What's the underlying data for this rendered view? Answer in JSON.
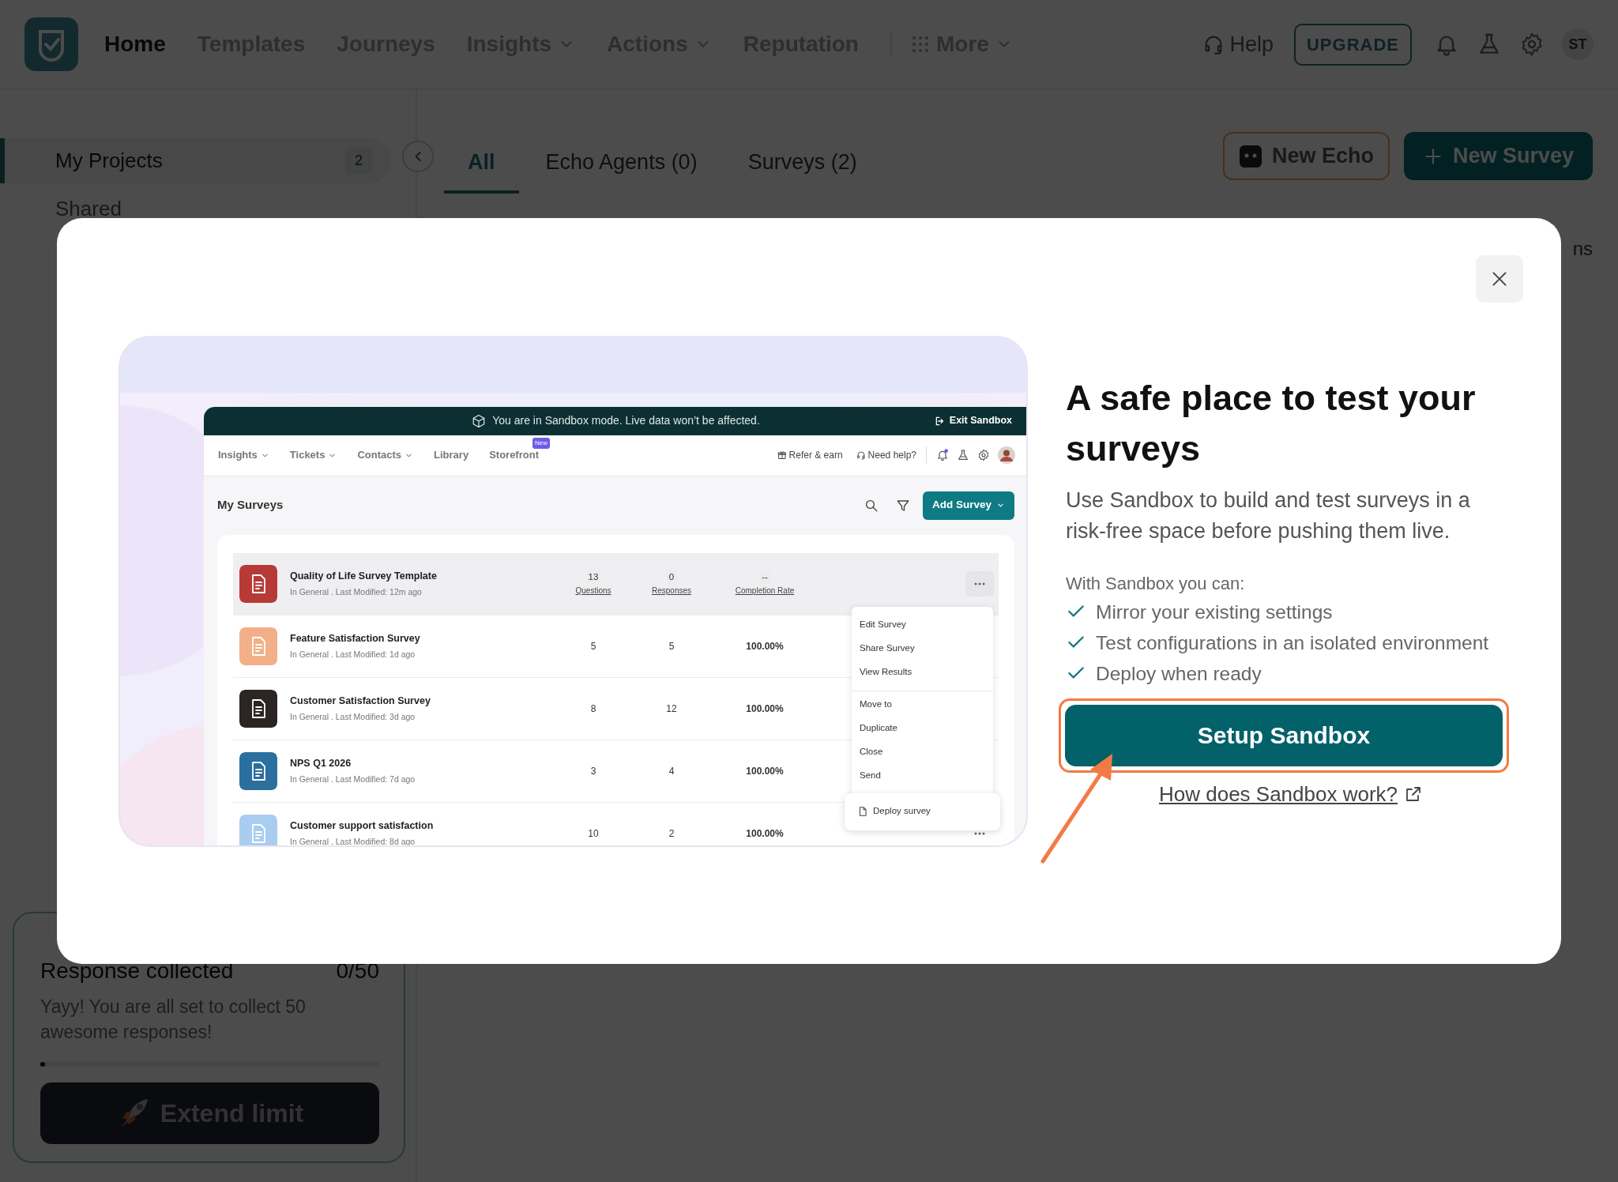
{
  "top_nav": {
    "items": [
      {
        "label": "Home",
        "selected": true,
        "dropdown": false
      },
      {
        "label": "Templates",
        "selected": false,
        "dropdown": false
      },
      {
        "label": "Journeys",
        "selected": false,
        "dropdown": false
      },
      {
        "label": "Insights",
        "selected": false,
        "dropdown": true
      },
      {
        "label": "Actions",
        "selected": false,
        "dropdown": true
      },
      {
        "label": "Reputation",
        "selected": false,
        "dropdown": false
      }
    ],
    "more": "More",
    "help": "Help",
    "upgrade": "UPGRADE",
    "avatar": "ST"
  },
  "sidebar": {
    "items": [
      {
        "label": "My Projects",
        "count": "2",
        "selected": true
      },
      {
        "label": "Shared",
        "selected": false
      }
    ]
  },
  "tabs": [
    {
      "label": "All",
      "selected": true
    },
    {
      "label": "Echo Agents (0)",
      "selected": false
    },
    {
      "label": "Surveys (2)",
      "selected": false
    }
  ],
  "header_buttons": {
    "new_echo": "New Echo",
    "new_survey": "New Survey"
  },
  "column_fragment": "ns",
  "usage_card": {
    "title": "Response collected",
    "count": "0/50",
    "message": "Yayy! You are all set to collect 50 awesome responses!",
    "level": 0.01,
    "button": "Extend limit"
  },
  "modal": {
    "preview": {
      "banner": "You are in Sandbox mode. Live data won’t be affected.",
      "exit": "Exit Sandbox",
      "nav": [
        {
          "label": "Insights",
          "dropdown": true
        },
        {
          "label": "Tickets",
          "dropdown": true
        },
        {
          "label": "Contacts",
          "dropdown": true
        },
        {
          "label": "Library",
          "dropdown": false
        },
        {
          "label": "Storefront",
          "dropdown": false,
          "badge": "New"
        }
      ],
      "refer": "Refer & earn",
      "help": "Need help?",
      "heading": "My Surveys",
      "add_button": "Add Survey",
      "rows": [
        {
          "title": "Quality of Life Survey Template",
          "meta": "In General . Last Modified: 12m ago",
          "color": "#b83a37",
          "hovered": true,
          "more_button": true,
          "stats": [
            {
              "value": "13",
              "label": "Questions"
            },
            {
              "value": "0",
              "label": "Responses"
            },
            {
              "value": "--",
              "label": "Completion Rate"
            }
          ]
        },
        {
          "title": "Feature Satisfaction Survey",
          "meta": "In General . Last Modified: 1d ago",
          "color": "#f3b088",
          "hovered": false,
          "more_button": false,
          "stats": [
            {
              "value": "5"
            },
            {
              "value": "5"
            },
            {
              "value": "100.00%"
            }
          ]
        },
        {
          "title": "Customer Satisfaction Survey",
          "meta": "In General . Last Modified: 3d ago",
          "color": "#2b2623",
          "hovered": false,
          "more_button": false,
          "stats": [
            {
              "value": "8"
            },
            {
              "value": "12"
            },
            {
              "value": "100.00%"
            }
          ]
        },
        {
          "title": "NPS Q1 2026",
          "meta": "In General . Last Modified: 7d ago",
          "color": "#2a6f9e",
          "hovered": false,
          "more_button": false,
          "stats": [
            {
              "value": "3"
            },
            {
              "value": "4"
            },
            {
              "value": "100.00%"
            }
          ]
        },
        {
          "title": "Customer support satisfaction",
          "meta": "In General . Last Modified: 8d ago",
          "color": "#a9cdf0",
          "hovered": false,
          "more_button": true,
          "stats": [
            {
              "value": "10"
            },
            {
              "value": "2"
            },
            {
              "value": "100.00%"
            }
          ]
        }
      ],
      "menu": [
        {
          "label": "Edit Survey",
          "divider_before": false
        },
        {
          "label": "Share Survey",
          "divider_before": false
        },
        {
          "label": "View Results",
          "divider_before": false
        },
        {
          "label": "Move to",
          "divider_before": true
        },
        {
          "label": "Duplicate",
          "divider_before": false
        },
        {
          "label": "Close",
          "divider_before": false
        },
        {
          "label": "Send",
          "divider_before": false
        }
      ],
      "deploy": "Deploy survey"
    },
    "title": "A safe place to test your surveys",
    "description": "Use Sandbox to build and test surveys in a risk-free space before pushing them live.",
    "list_heading": "With Sandbox you can:",
    "features": [
      "Mirror your existing settings",
      "Test configurations in an isolated environment",
      "Deploy when ready"
    ],
    "primary_button": "Setup Sandbox",
    "highlighted": true,
    "link": "How does Sandbox work?"
  }
}
